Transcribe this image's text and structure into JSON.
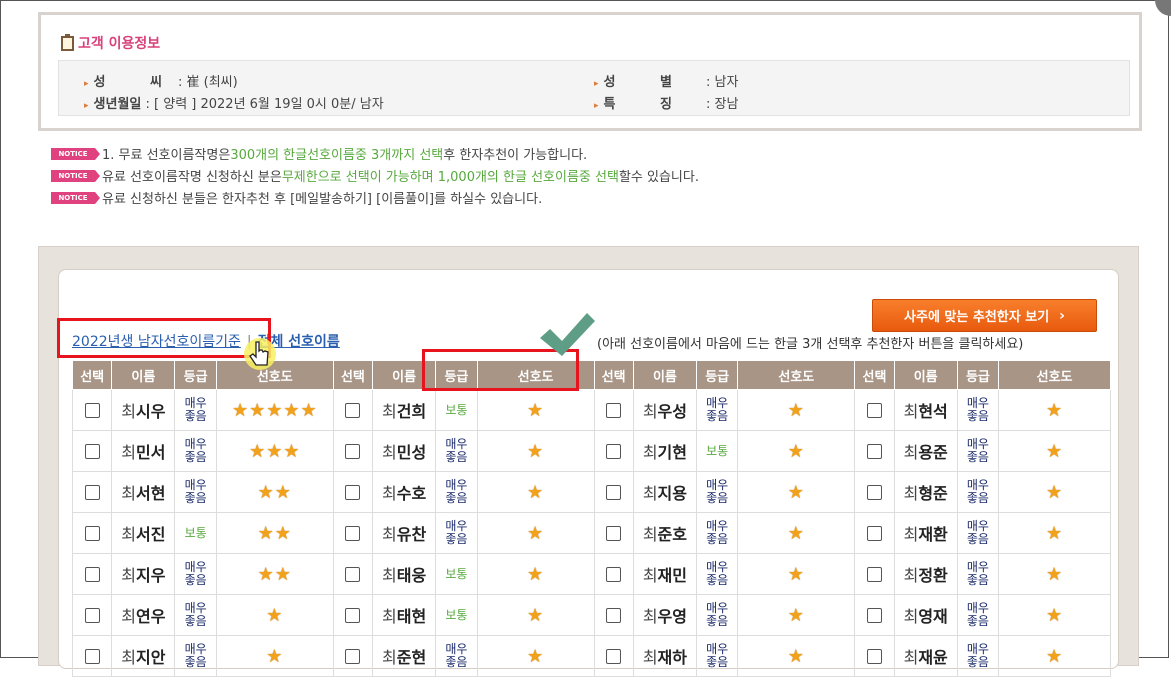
{
  "customer": {
    "title": "고객 이용정보",
    "surname_label": "성 씨",
    "surname_value": ": 崔 (최씨)",
    "gender_label": "성 별",
    "gender_value": ": 남자",
    "birth_label": "생년월일",
    "birth_value": ": [ 양력 ] 2022년 6월 19일 0시 0분/ 남자",
    "feature_label": "특 징",
    "feature_value": ": 장남"
  },
  "notices": {
    "badge": "NOTICE",
    "n1_a": "1. 무료 선호이름작명은 ",
    "n1_b": "300개의 한글선호이름중 3개까지 선택",
    "n1_c": "후 한자추천이 가능합니다.",
    "n2_a": "유료 선호이름작명 신청하신 분은",
    "n2_b": "무제한으로 선택이 가능하며 1,000개의 한글 선호이름중 선택",
    "n2_c": "할수 있습니다.",
    "n3": "유료 신청하신 분들은 한자추천 후 [메일발송하기] [이름풀이]를 하실수 있습니다."
  },
  "tabs": {
    "tab1": "2022년생 남자선호이름기준",
    "separator": "|",
    "tab2": "전체 선호이름"
  },
  "recommend_button": "사주에 맞는 추천한자 보기",
  "guide": "(아래 선호이름에서 마음에 드는 한글 3개 선택후 추천한자 버튼을 클릭하세요)",
  "columns": [
    "선택",
    "이름",
    "등급",
    "선호도"
  ],
  "surname": "최",
  "grades": {
    "very_good": "매우좋음",
    "normal": "보통"
  },
  "rows": [
    [
      {
        "n": "시우",
        "g": "very_good",
        "s": 5
      },
      {
        "n": "건희",
        "g": "normal",
        "s": 1
      },
      {
        "n": "우성",
        "g": "very_good",
        "s": 1
      },
      {
        "n": "현석",
        "g": "very_good",
        "s": 1
      }
    ],
    [
      {
        "n": "민서",
        "g": "very_good",
        "s": 3
      },
      {
        "n": "민성",
        "g": "very_good",
        "s": 1
      },
      {
        "n": "기현",
        "g": "normal",
        "s": 1
      },
      {
        "n": "용준",
        "g": "very_good",
        "s": 1
      }
    ],
    [
      {
        "n": "서현",
        "g": "very_good",
        "s": 2
      },
      {
        "n": "수호",
        "g": "very_good",
        "s": 1
      },
      {
        "n": "지용",
        "g": "very_good",
        "s": 1
      },
      {
        "n": "형준",
        "g": "very_good",
        "s": 1
      }
    ],
    [
      {
        "n": "서진",
        "g": "normal",
        "s": 2
      },
      {
        "n": "유찬",
        "g": "very_good",
        "s": 1
      },
      {
        "n": "준호",
        "g": "very_good",
        "s": 1
      },
      {
        "n": "재환",
        "g": "very_good",
        "s": 1
      }
    ],
    [
      {
        "n": "지우",
        "g": "very_good",
        "s": 2
      },
      {
        "n": "태웅",
        "g": "normal",
        "s": 1
      },
      {
        "n": "재민",
        "g": "very_good",
        "s": 1
      },
      {
        "n": "정환",
        "g": "very_good",
        "s": 1
      }
    ],
    [
      {
        "n": "연우",
        "g": "very_good",
        "s": 1
      },
      {
        "n": "태현",
        "g": "normal",
        "s": 1
      },
      {
        "n": "우영",
        "g": "very_good",
        "s": 1
      },
      {
        "n": "영재",
        "g": "very_good",
        "s": 1
      }
    ],
    [
      {
        "n": "지안",
        "g": "very_good",
        "s": 1
      },
      {
        "n": "준현",
        "g": "very_good",
        "s": 1
      },
      {
        "n": "재하",
        "g": "very_good",
        "s": 1
      },
      {
        "n": "재윤",
        "g": "very_good",
        "s": 1
      }
    ]
  ]
}
